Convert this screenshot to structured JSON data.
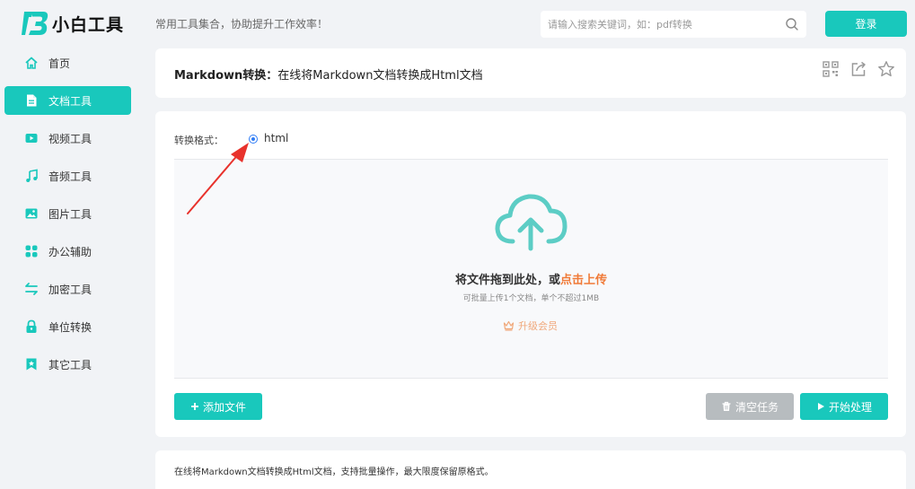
{
  "brand": {
    "name": "小白工具"
  },
  "header": {
    "slogan": "常用工具集合，协助提升工作效率！",
    "search_placeholder": "请输入搜索关键词，如：pdf转换",
    "login_label": "登录"
  },
  "sidebar": {
    "items": [
      {
        "label": "首页",
        "icon": "home-icon",
        "active": false
      },
      {
        "label": "文档工具",
        "icon": "document-icon",
        "active": true
      },
      {
        "label": "视频工具",
        "icon": "video-icon",
        "active": false
      },
      {
        "label": "音频工具",
        "icon": "music-note-icon",
        "active": false
      },
      {
        "label": "图片工具",
        "icon": "image-icon",
        "active": false
      },
      {
        "label": "办公辅助",
        "icon": "grid-icon",
        "active": false
      },
      {
        "label": "加密工具",
        "icon": "swap-arrows-icon",
        "active": false
      },
      {
        "label": "单位转换",
        "icon": "lock-icon",
        "active": false
      },
      {
        "label": "其它工具",
        "icon": "bookmark-icon",
        "active": false
      }
    ]
  },
  "tool": {
    "name": "Markdown转换",
    "separator": "：",
    "description": "在线将Markdown文档转换成Html文档",
    "icons": [
      "qrcode-icon",
      "share-icon",
      "star-icon"
    ]
  },
  "converter": {
    "format_label": "转换格式：",
    "format_options": [
      {
        "label": "html",
        "selected": true
      }
    ],
    "drop_text": "将文件拖到此处，或",
    "drop_link": "点击上传",
    "limit_text": "可批量上传1个文档，单个不超过1MB",
    "upgrade_label": "升级会员",
    "add_file_label": "添加文件",
    "clear_label": "清空任务",
    "start_label": "开始处理"
  },
  "footer_description": "在线将Markdown文档转换成Html文档，支持批量操作，最大限度保留原格式。",
  "colors": {
    "accent": "#19c8bc",
    "upload_link": "#f07a37",
    "disabled_button": "#b7bcbf",
    "radio": "#2f7cf6",
    "annotation_arrow": "#e8322c"
  }
}
